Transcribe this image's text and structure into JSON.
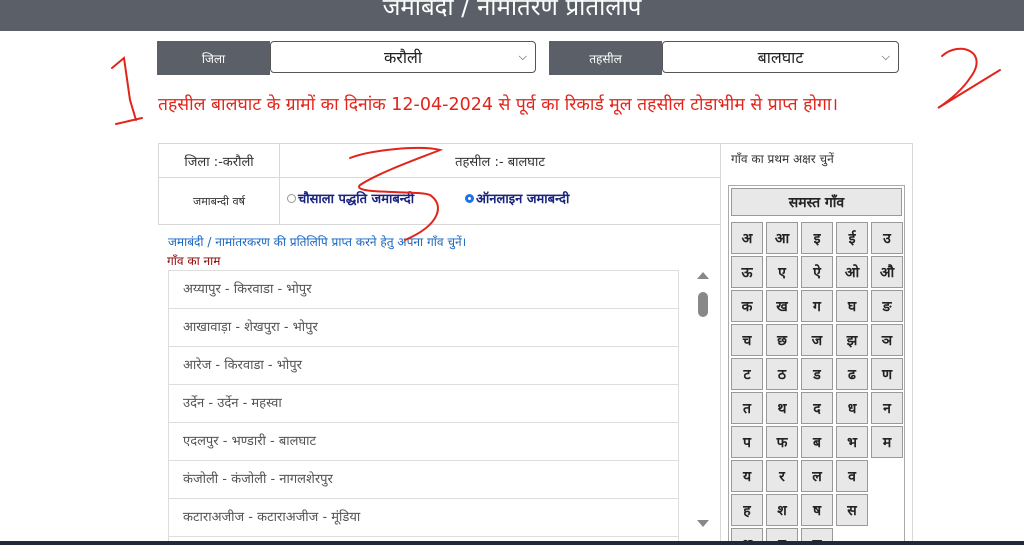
{
  "header": {
    "title": "जमाबंदी / नामांतरण प्रतिलिपि"
  },
  "filters": {
    "district_label": "जिला",
    "district_value": "करौली",
    "tehsil_label": "तहसील",
    "tehsil_value": "बालघाट",
    "chevron_icon": "chevron-down-icon"
  },
  "notice": "तहसील बालघाट के ग्रामों का दिनांक 12-04-2024 से पूर्व का रिकार्ड मूल तहसील टोडाभीम से प्राप्त होगा।",
  "annotations": {
    "marker_1": "1",
    "marker_2": "2",
    "annotation_color": "#e1251b"
  },
  "info": {
    "district": "जिला :-करौली",
    "tehsil": "तहसील :- बालघाट",
    "jamabandi_year_label": "जमाबन्दी वर्ष",
    "option_chausala": "चौसाला पद्धति जमाबन्दी",
    "option_online": "ऑनलाइन जमाबन्दी",
    "selected_option": "ऑनलाइन जमाबन्दी"
  },
  "village_picker": {
    "instruction": "जमाबंदी / नामांतरकरण की प्रतिलिपि प्राप्त करने हेतु अपना गाँव चुनें।",
    "label": "गाँव का नाम",
    "villages": [
      "अय्यापुर - किरवाडा - भोपुर",
      "आखावाड़ा - शेखपुरा - भोपुर",
      "आरेज - किरवाडा - भोपुर",
      "उर्देन - उर्देन - महस्वा",
      "एदलपुर - भण्डारी - बालघाट",
      "कंजोली - कंजोली - नागलशेरपुर",
      "कटाराअजीज - कटाराअजीज - मूंडिया"
    ]
  },
  "alphabet": {
    "heading": "गाँव का प्रथम अक्षर चुनें",
    "all_villages": "समस्त गाँव",
    "letters": [
      "अ",
      "आ",
      "इ",
      "ई",
      "उ",
      "ऊ",
      "ए",
      "ऐ",
      "ओ",
      "औ",
      "क",
      "ख",
      "ग",
      "घ",
      "ङ",
      "च",
      "छ",
      "ज",
      "झ",
      "ञ",
      "ट",
      "ठ",
      "ड",
      "ढ",
      "ण",
      "त",
      "थ",
      "द",
      "ध",
      "न",
      "प",
      "फ",
      "ब",
      "भ",
      "म",
      "य",
      "र",
      "ल",
      "व",
      "ह",
      "श",
      "ष",
      "स",
      "क्ष",
      "त्र",
      "ज्ञ"
    ]
  }
}
